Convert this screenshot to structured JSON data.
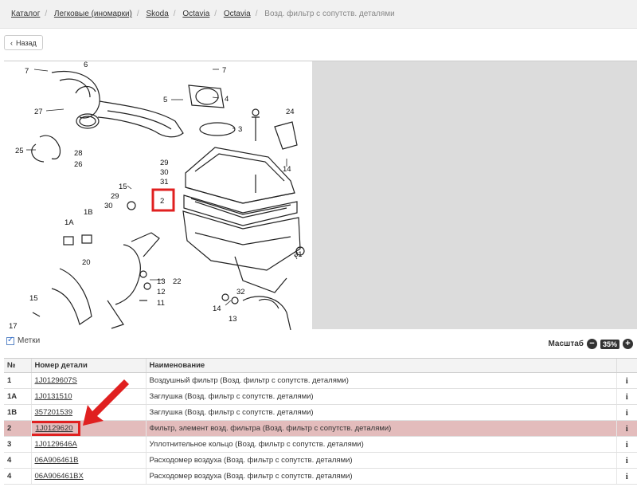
{
  "breadcrumb": {
    "items": [
      "Каталог",
      "Легковые (иномарки)",
      "Skoda",
      "Octavia",
      "Octavia"
    ],
    "current": "Возд. фильтр с сопутств. деталями"
  },
  "back": {
    "label": "Назад"
  },
  "controls": {
    "labels_toggle": "Метки",
    "zoom_label": "Масштаб",
    "zoom_value": "35%"
  },
  "diagram": {
    "callouts": [
      "7",
      "6",
      "7",
      "4",
      "5",
      "27",
      "3",
      "24",
      "25",
      "26",
      "28",
      "29",
      "30",
      "31",
      "15",
      "29",
      "30",
      "14",
      "2",
      "1A",
      "1B",
      "20",
      "13",
      "22",
      "12",
      "11",
      "31",
      "15",
      "32",
      "14",
      "13",
      "17"
    ],
    "highlighted_callout": "2"
  },
  "table": {
    "headers": [
      "№",
      "Номер детали",
      "Наименование",
      ""
    ],
    "rows": [
      {
        "num": "1",
        "part": "1J0129607S",
        "name": "Воздушный фильтр (Возд. фильтр с сопутств. деталями)",
        "info": "i"
      },
      {
        "num": "1A",
        "part": "1J0131510",
        "name": "Заглушка (Возд. фильтр с сопутств. деталями)",
        "info": "i"
      },
      {
        "num": "1B",
        "part": "357201539",
        "name": "Заглушка (Возд. фильтр с сопутств. деталями)",
        "info": "i"
      },
      {
        "num": "2",
        "part": "1J0129620",
        "name": "Фильтр, элемент возд. фильтра (Возд. фильтр с сопутств. деталями)",
        "info": "i"
      },
      {
        "num": "3",
        "part": "1J0129646A",
        "name": "Уплотнительное кольцо (Возд. фильтр с сопутств. деталями)",
        "info": "i"
      },
      {
        "num": "4",
        "part": "06A906461B",
        "name": "Расходомер воздуха (Возд. фильтр с сопутств. деталями)",
        "info": "i"
      },
      {
        "num": "4",
        "part": "06A906461BX",
        "name": "Расходомер воздуха (Возд. фильтр с сопутств. деталями)",
        "info": "i"
      }
    ]
  },
  "colors": {
    "highlight": "#e02020",
    "selected_row": "#e3bcbc"
  }
}
